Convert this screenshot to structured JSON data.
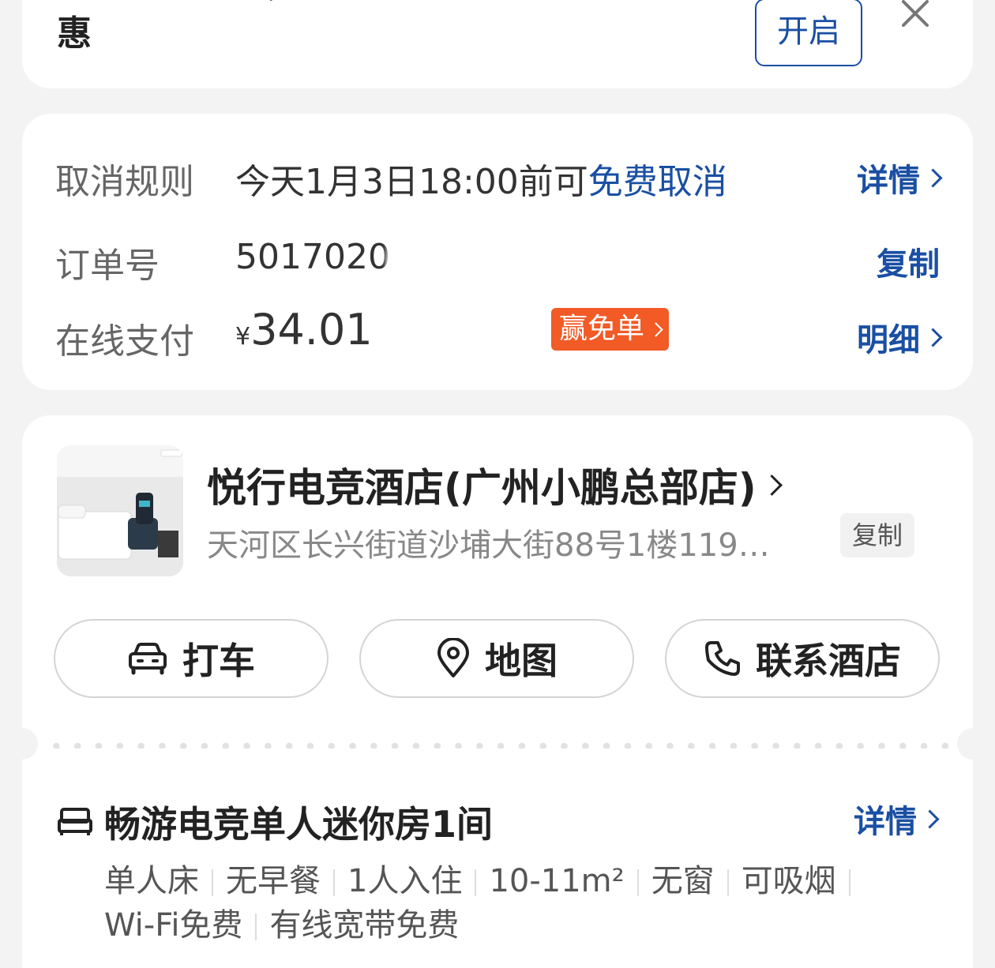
{
  "notice": {
    "text_line1": "开启消息通知，不错过订单提醒/优",
    "text_line2": "惠",
    "open_label": "开启"
  },
  "order": {
    "cancel": {
      "label": "取消规则",
      "value_prefix": "今天1月3日18:00前可",
      "value_highlight": "免费取消",
      "action": "详情"
    },
    "order_no": {
      "label": "订单号",
      "value": "5017020",
      "action": "复制"
    },
    "payment": {
      "label": "在线支付",
      "currency": "¥",
      "amount": "34.01",
      "badge": "赢免单",
      "action": "明细"
    }
  },
  "hotel": {
    "name": "悦行电竞酒店(广州小鹏总部店)",
    "address": "天河区长兴街道沙埔大街88号1楼119…",
    "copy_label": "复制",
    "buttons": {
      "taxi": "打车",
      "map": "地图",
      "call": "联系酒店"
    }
  },
  "room": {
    "title": "畅游电竞单人迷你房1间",
    "action": "详情",
    "tags": [
      "单人床",
      "无早餐",
      "1人入住",
      "10-11m²",
      "无窗",
      "可吸烟",
      "Wi-Fi免费",
      "有线宽带免费"
    ]
  },
  "colors": {
    "accent_blue": "#1a4fa3",
    "price_red": "#e8372d",
    "badge_orange": "#f25a26",
    "background": "#f3f3f3"
  }
}
